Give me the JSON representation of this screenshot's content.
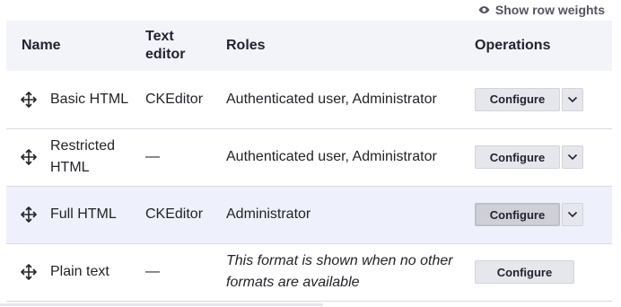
{
  "toolbar": {
    "show_row_weights_label": "Show row weights"
  },
  "table": {
    "headers": {
      "name": "Name",
      "editor": "Text editor",
      "roles": "Roles",
      "operations": "Operations"
    },
    "rows": [
      {
        "name": "Basic HTML",
        "editor": "CKEditor",
        "roles": "Authenticated user, Administrator",
        "configure_label": "Configure",
        "has_dropdown": true
      },
      {
        "name": "Restricted HTML",
        "editor": "—",
        "roles": "Authenticated user, Administrator",
        "configure_label": "Configure",
        "has_dropdown": true
      },
      {
        "name": "Full HTML",
        "editor": "CKEditor",
        "roles": "Administrator",
        "configure_label": "Configure",
        "has_dropdown": true,
        "highlighted": true
      },
      {
        "name": "Plain text",
        "editor": "—",
        "roles": "This format is shown when no other formats are available",
        "configure_label": "Configure",
        "has_dropdown": false
      }
    ]
  },
  "icons": {
    "eye": "eye-icon",
    "drag": "drag-handle-icon",
    "caret": "chevron-down-icon"
  },
  "colors": {
    "header_bg": "#f3f4f9",
    "highlight_row_bg": "#eef1fb",
    "button_bg": "#e6e7ec",
    "text": "#222330"
  }
}
